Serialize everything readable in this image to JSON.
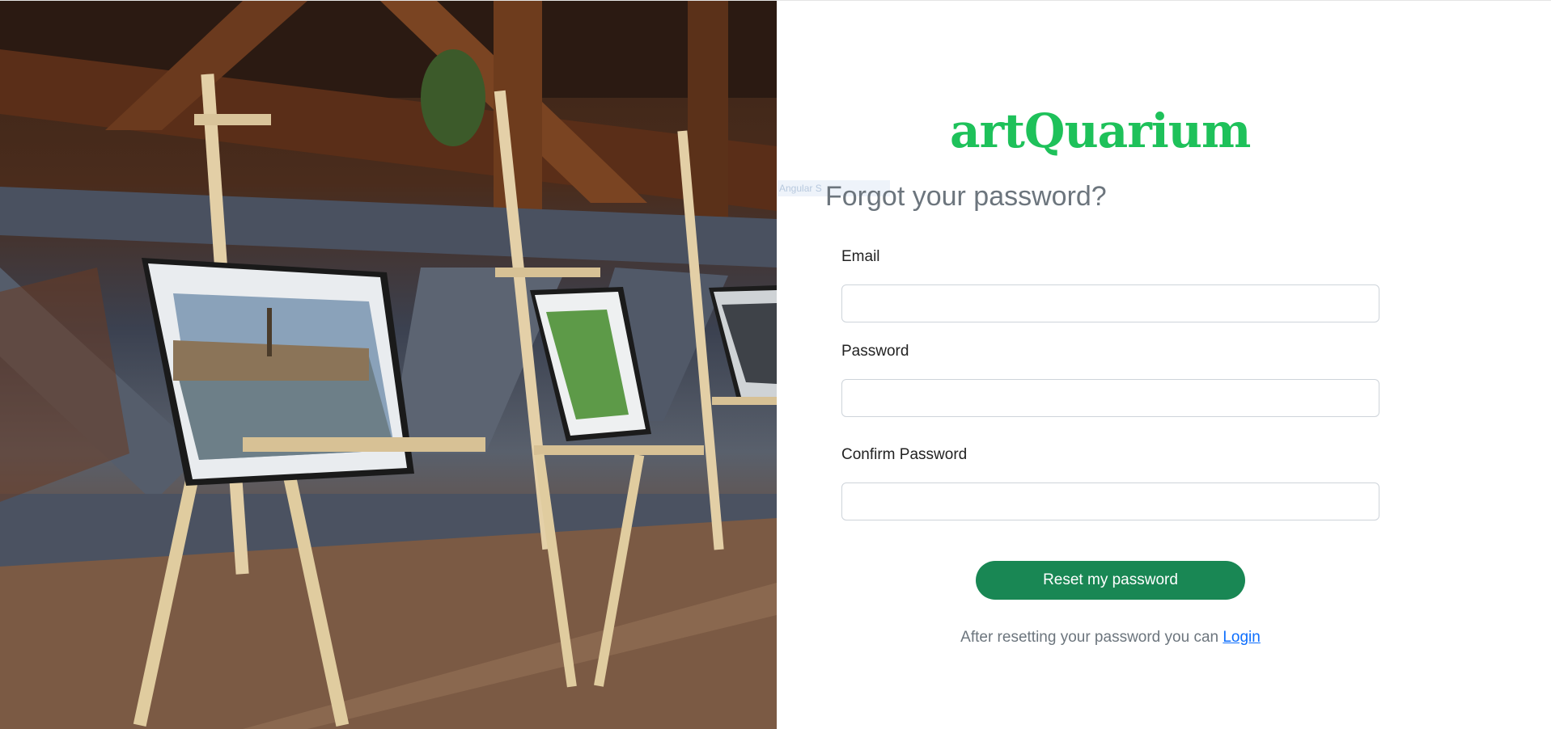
{
  "brand": {
    "name": "artQuarium",
    "color": "#1ec15a"
  },
  "tooltip_ghost": "Angular S",
  "page_title": "Forgot your password?",
  "form": {
    "email_label": "Email",
    "email_value": "",
    "password_label": "Password",
    "password_value": "",
    "confirm_label": "Confirm Password",
    "confirm_value": "",
    "submit_label": "Reset my password"
  },
  "footer": {
    "prefix": "After resetting your password you can ",
    "login_link": "Login"
  },
  "colors": {
    "primary_button": "#198754",
    "link": "#0d6efd",
    "muted_text": "#6c757d"
  },
  "illustration": {
    "subject": "gallery-easels-photo"
  }
}
